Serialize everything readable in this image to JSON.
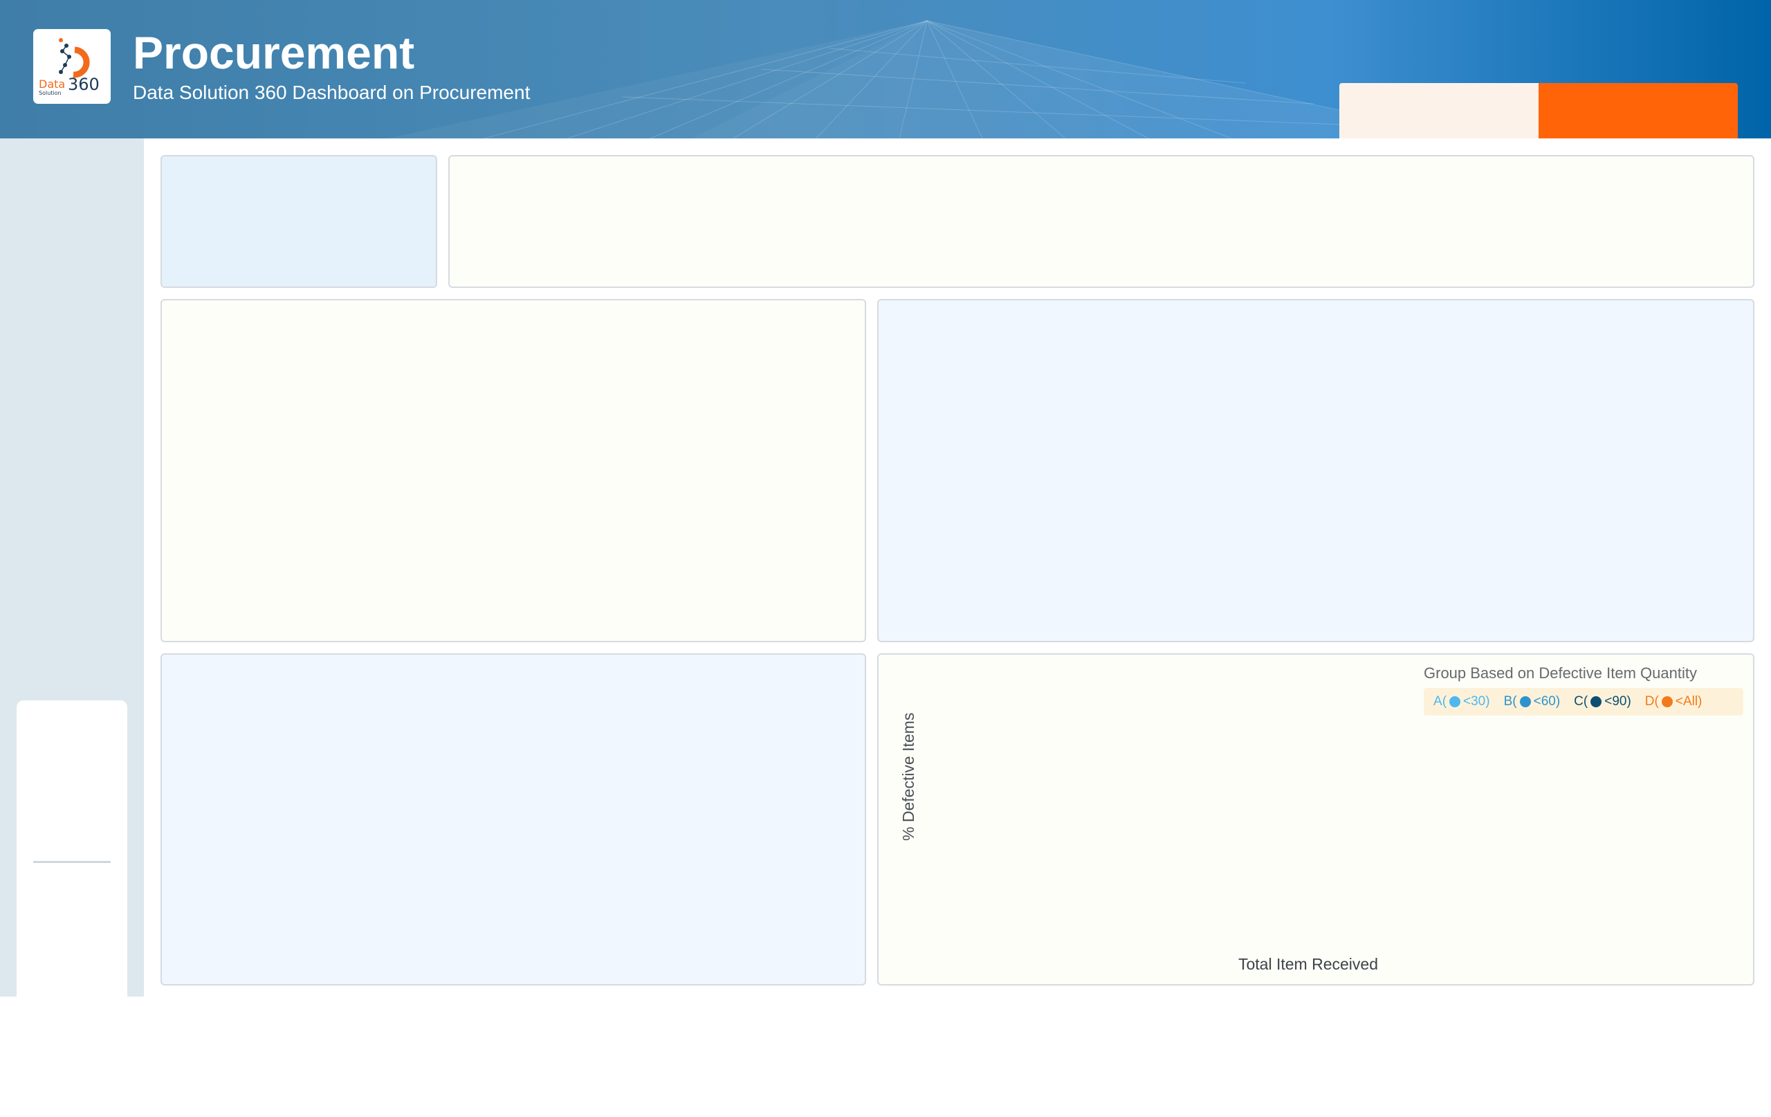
{
  "header": {
    "title": "Procurement",
    "subtitle": "Data Solution 360 Dashboard on Procurement",
    "logo": {
      "word_data": "Data",
      "word_360": "360",
      "word_solution": "Solution",
      "icon": "data-solution-360-logo"
    },
    "colors": {
      "accent": "#ff6508",
      "tab_light": "#fdf2ea"
    }
  },
  "scatter_panel": {
    "legend_title": "Group Based on Defective Item Quantity",
    "legend": [
      {
        "letter": "A",
        "open": "(",
        "threshold": "<30)",
        "color": "#4fb7ee"
      },
      {
        "letter": "B",
        "open": "(",
        "threshold": "<60)",
        "color": "#2e93cc"
      },
      {
        "letter": "C",
        "open": "(",
        "threshold": "<90)",
        "color": "#0b4f73"
      },
      {
        "letter": "D",
        "open": "(",
        "threshold": "<All)",
        "color": "#f27a1a"
      }
    ],
    "y_axis_label": "% Defective Items",
    "x_axis_label": "Total Item Received"
  }
}
